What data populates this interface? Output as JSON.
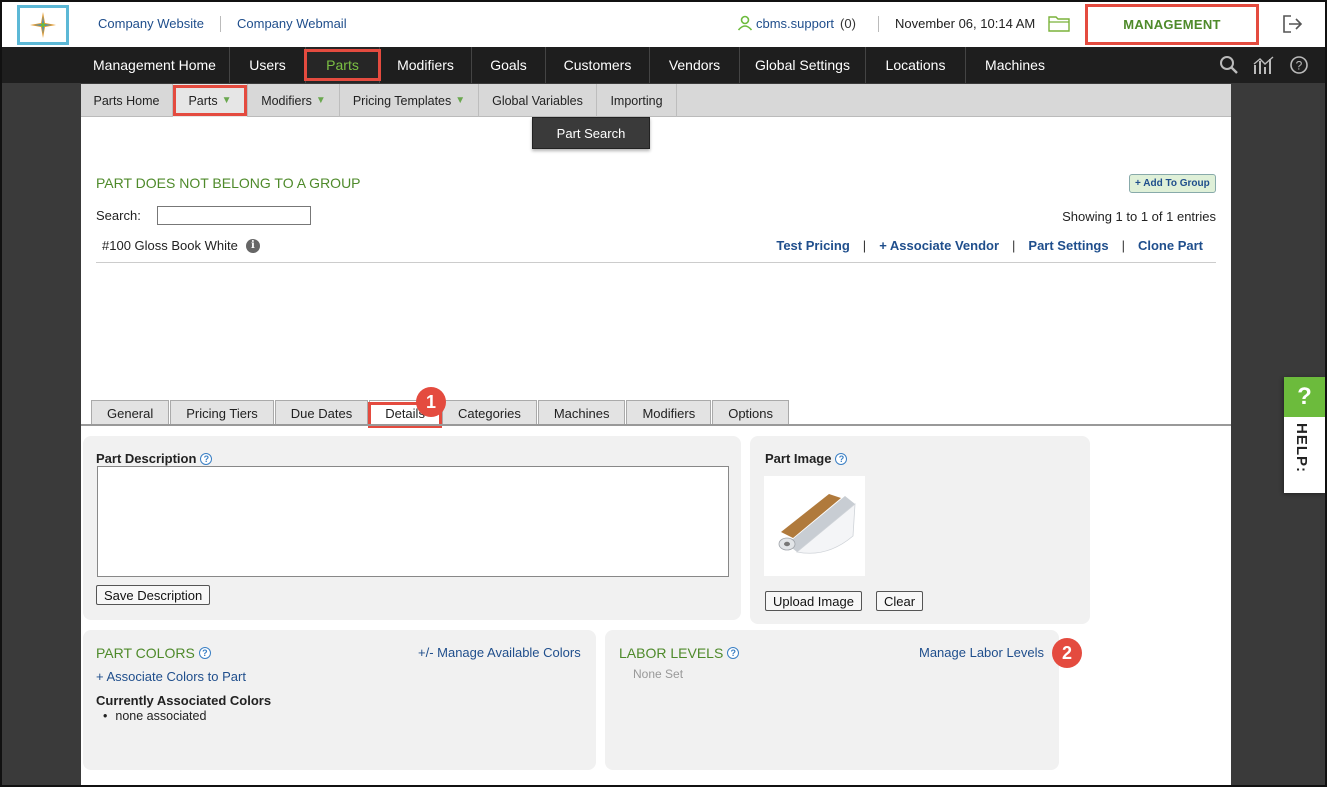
{
  "header": {
    "links": [
      "Company Website",
      "Company Webmail"
    ],
    "user": "cbms.support",
    "user_count": "(0)",
    "datetime": "November 06, 10:14 AM",
    "management_label": "MANAGEMENT"
  },
  "mainnav": {
    "items": [
      "Management Home",
      "Users",
      "Parts",
      "Modifiers",
      "Goals",
      "Customers",
      "Vendors",
      "Global Settings",
      "Locations",
      "Machines"
    ],
    "active": "Parts"
  },
  "subnav": {
    "items": [
      "Parts Home",
      "Parts",
      "Modifiers",
      "Pricing Templates",
      "Global Variables",
      "Importing"
    ],
    "active": "Parts",
    "dropdown_item": "Part Search"
  },
  "page": {
    "title": "PART DOES NOT BELONG TO A GROUP",
    "add_to_group": "+ Add To Group",
    "search_label": "Search:",
    "search_value": "",
    "showing": "Showing 1 to 1 of 1 entries",
    "part_name": "#100 Gloss Book White",
    "actions": [
      "Test Pricing",
      "+ Associate Vendor",
      "Part Settings",
      "Clone Part"
    ]
  },
  "tabs": {
    "items": [
      "General",
      "Pricing Tiers",
      "Due Dates",
      "Details",
      "Categories",
      "Machines",
      "Modifiers",
      "Options"
    ],
    "active": "Details"
  },
  "badges": [
    "1",
    "2"
  ],
  "description": {
    "label": "Part Description",
    "value": "",
    "save_button": "Save Description"
  },
  "image": {
    "label": "Part Image",
    "upload_button": "Upload Image",
    "clear_button": "Clear"
  },
  "colors": {
    "title": "PART COLORS",
    "manage_link": "+/- Manage Available Colors",
    "associate_link": "+ Associate Colors to Part",
    "current_label": "Currently Associated Colors",
    "items": [
      "none associated"
    ]
  },
  "labor": {
    "title": "LABOR LEVELS",
    "manage_link": "Manage Labor Levels",
    "empty": "None Set"
  },
  "help": {
    "q": "?",
    "label": "HELP:"
  },
  "colors_theme": {
    "accent_green": "#4e8a2a",
    "link_blue": "#1f4e8c",
    "highlight_red": "#e44b3f",
    "nav_dark": "#1e1e1e"
  }
}
